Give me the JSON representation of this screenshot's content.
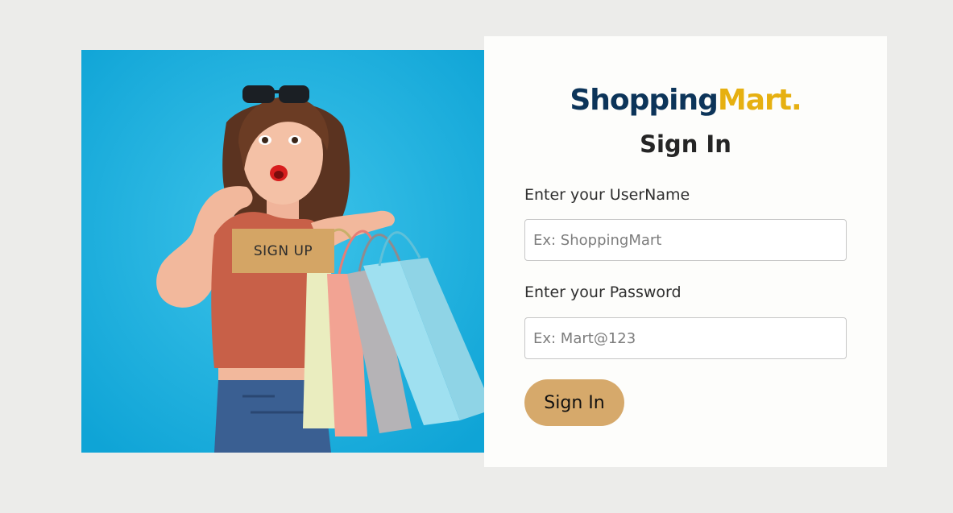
{
  "hero": {
    "signup_label": "SIGN UP"
  },
  "card": {
    "brand_part1": "Shopping",
    "brand_part2": "Mart.",
    "title": "Sign In",
    "username_label": "Enter your UserName",
    "username_placeholder": "Ex: ShoppingMart",
    "password_label": "Enter your Password",
    "password_placeholder": "Ex: Mart@123",
    "signin_label": "Sign In"
  },
  "colors": {
    "page_bg": "#ececea",
    "hero_bg": "#1aaedd",
    "brand_primary": "#0c3459",
    "brand_accent": "#e6b011",
    "button_bg": "#d6a96b"
  }
}
